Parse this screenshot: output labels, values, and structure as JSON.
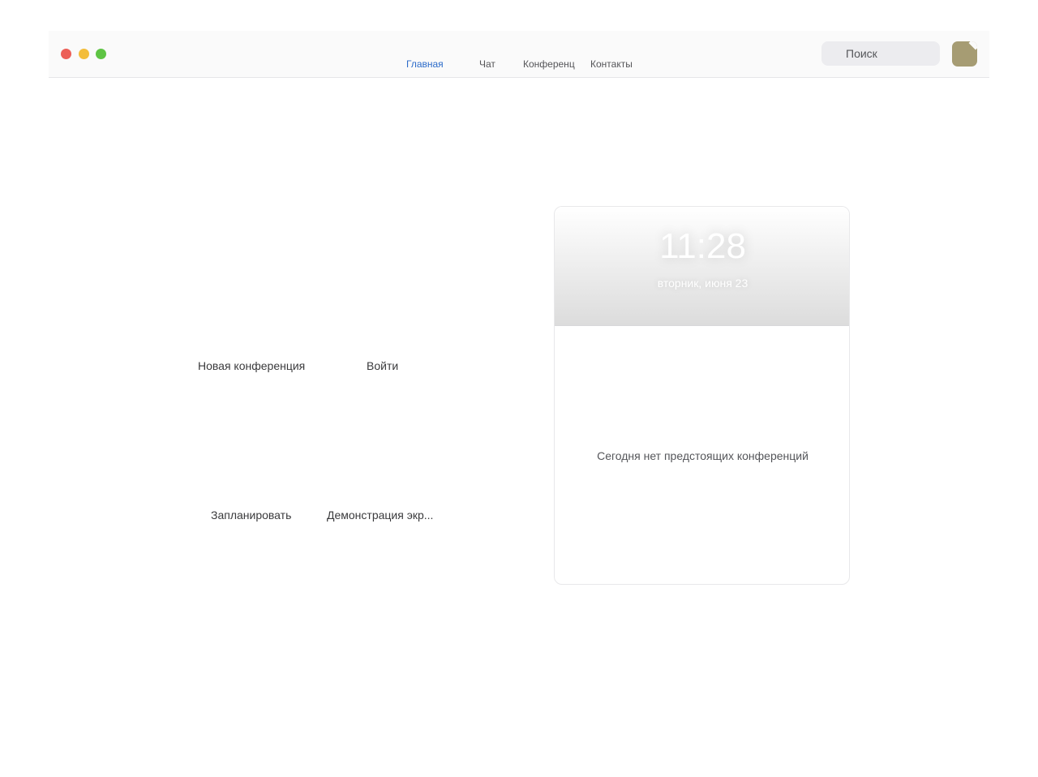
{
  "tabs": {
    "home": "Главная",
    "chat": "Чат",
    "meetings": "Конференц",
    "contacts": "Контакты"
  },
  "search": {
    "placeholder": "Поиск"
  },
  "actions": {
    "new_meeting": "Новая конференция",
    "join": "Войти",
    "schedule": "Запланировать",
    "share_screen": "Демонстрация экр..."
  },
  "clock": {
    "time": "11:28",
    "date": "вторник, июня 23"
  },
  "upcoming": {
    "empty_message": "Сегодня нет предстоящих конференций"
  },
  "colors": {
    "active_tab": "#2c6bc9",
    "close": "#ec5f57",
    "minimize": "#f3bd3a",
    "zoom": "#5ec444",
    "avatar": "#a69c73"
  }
}
